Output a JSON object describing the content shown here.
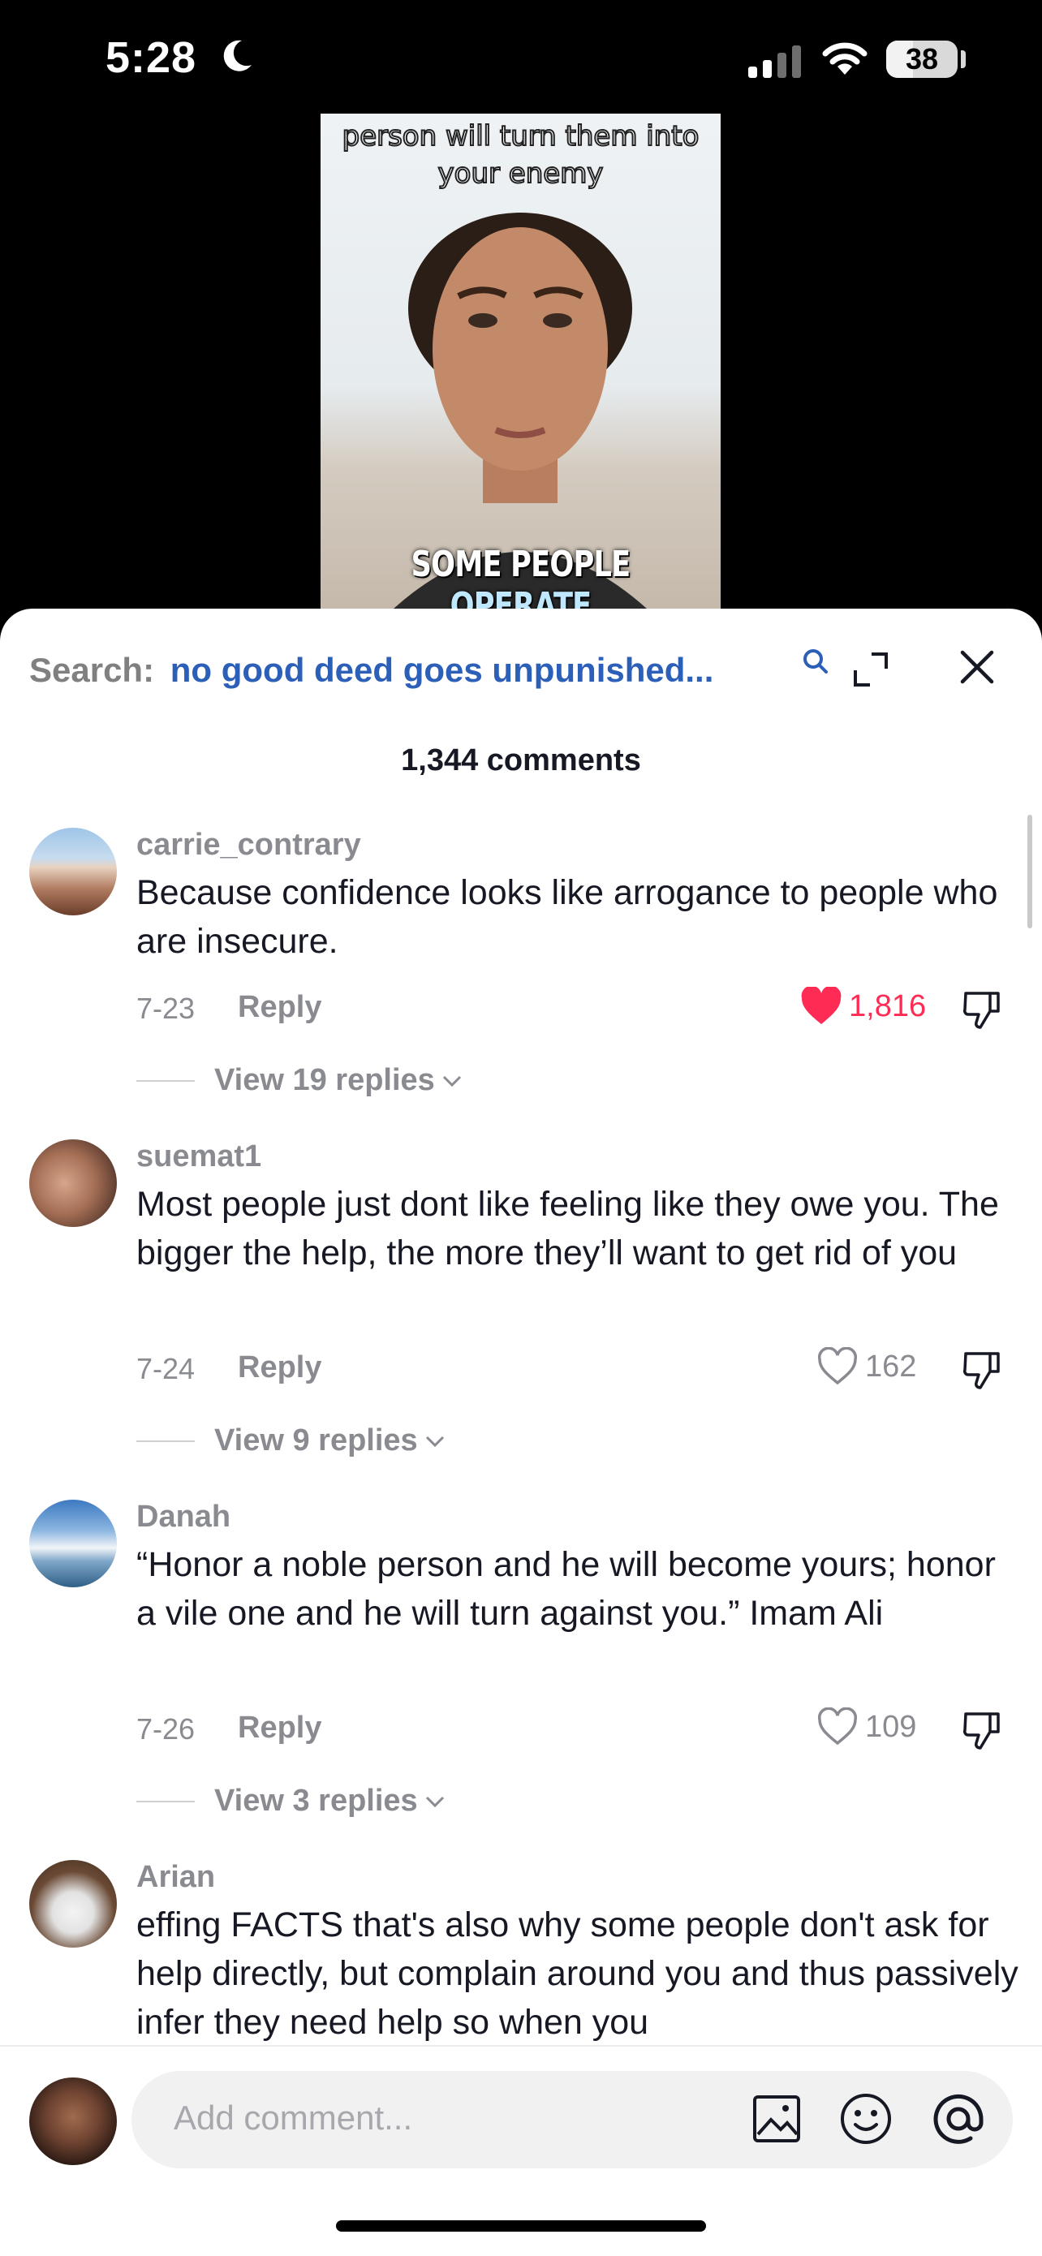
{
  "status_bar": {
    "time": "5:28",
    "battery": "38",
    "battery_level": 0.38
  },
  "video": {
    "caption_top_lines": [
      "person will turn them into",
      "your enemy"
    ],
    "caption_bottom": "SOME PEOPLE",
    "caption_bottom_highlight": "OPERATE"
  },
  "search": {
    "label": "Search:",
    "query": "no good deed goes unpunished..."
  },
  "comments_count": "1,344 comments",
  "comments": [
    {
      "username": "carrie_contrary",
      "text": "Because confidence looks like arrogance to people who are insecure.",
      "date": "7-23",
      "reply_label": "Reply",
      "likes": "1,816",
      "liked": true,
      "view_replies": "View 19 replies"
    },
    {
      "username": "suemat1",
      "text": "Most people just dont like feeling like they owe you. The bigger the help, the more they’ll want to get rid of you",
      "date": "7-24",
      "reply_label": "Reply",
      "likes": "162",
      "liked": false,
      "view_replies": "View 9 replies"
    },
    {
      "username": "Danah",
      "text": "“Honor a noble person and he will become yours; honor a vile one and he will turn against you.” Imam Ali",
      "date": "7-26",
      "reply_label": "Reply",
      "likes": "109",
      "liked": false,
      "view_replies": "View 3 replies"
    },
    {
      "username": "Arian",
      "text": "effing FACTS that's also why some people don't ask for help directly, but complain around you and thus passively infer they need help so when you"
    }
  ],
  "composer": {
    "placeholder": "Add comment..."
  },
  "colors": {
    "accent_blue": "#2c5fb7",
    "like_red": "#fe2c55",
    "muted": "#8a8b91"
  },
  "icons": [
    "moon-icon",
    "signal-icon",
    "wifi-icon",
    "search-icon",
    "expand-icon",
    "close-icon",
    "heart-icon",
    "dislike-icon",
    "chevron-down-icon",
    "image-icon",
    "emoji-icon",
    "at-icon"
  ]
}
